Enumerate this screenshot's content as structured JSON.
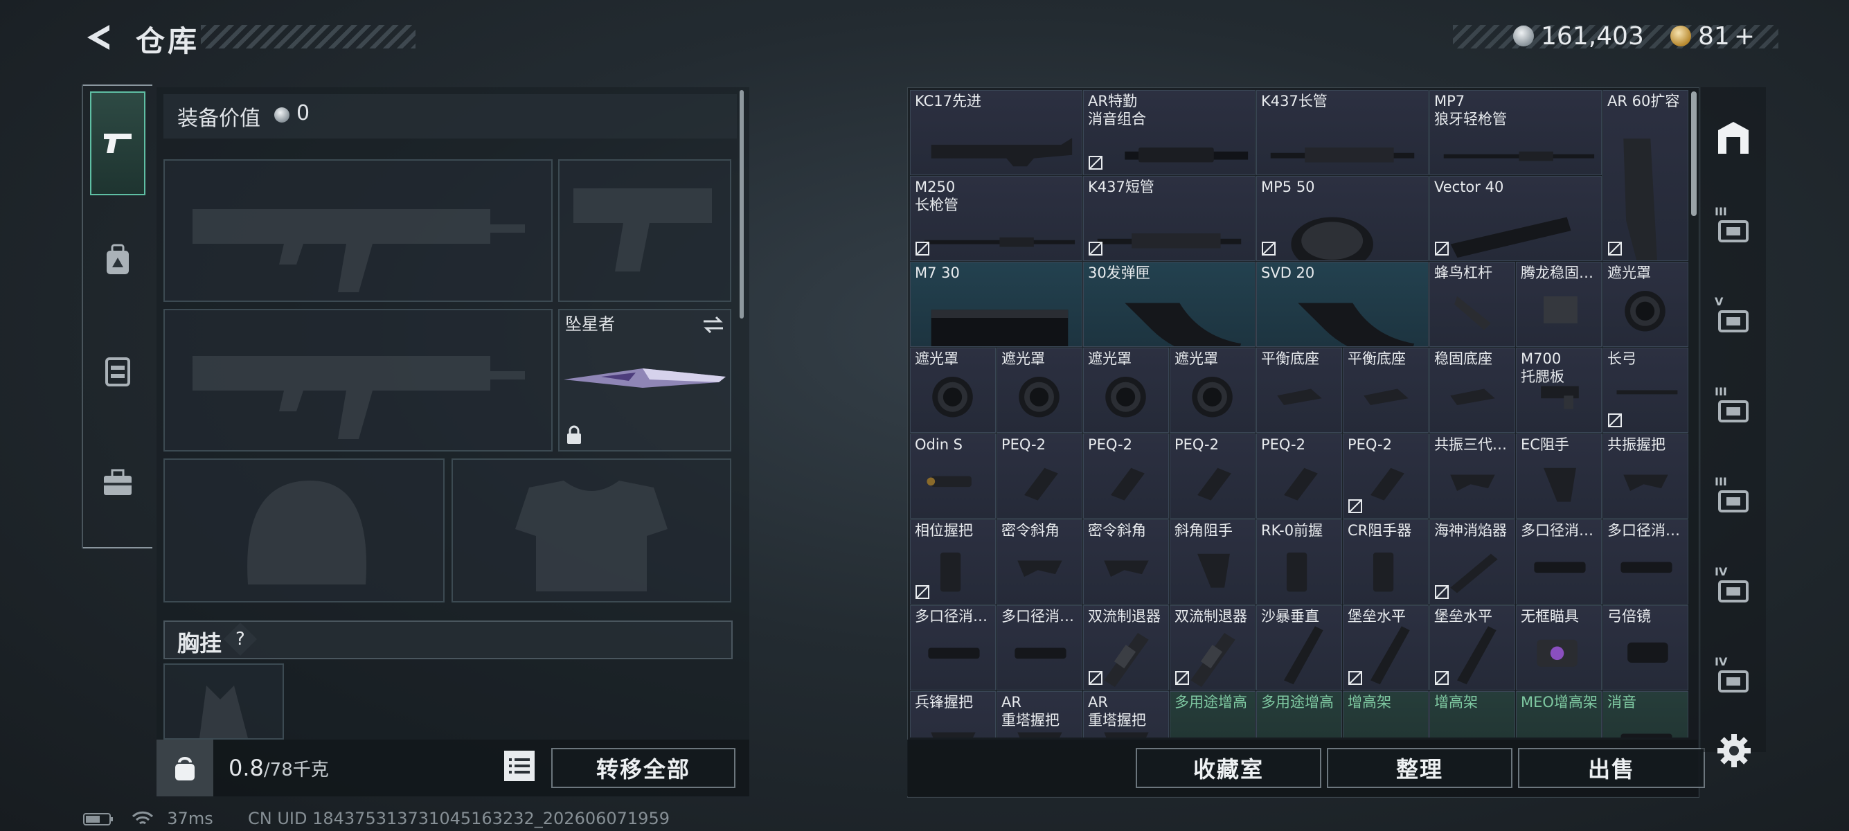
{
  "header": {
    "title": "仓库",
    "currency1": "161,403",
    "currency2": "81",
    "plus": "+"
  },
  "left_nav": [
    "weapon-icon",
    "backpack-icon",
    "vest-icon",
    "toolbox-icon"
  ],
  "equip": {
    "value_label": "装备价值",
    "value": "0",
    "melee_name": "坠星者",
    "chest_label": "胸挂",
    "help": "?"
  },
  "bottom_left": {
    "weight": "0.8",
    "weight_max": "/78千克",
    "transfer_label": "转移全部"
  },
  "bottom_right": {
    "collection": "收藏室",
    "sort": "整理",
    "sell": "出售"
  },
  "status": {
    "ping": "37ms",
    "uid": "CN UID 184375313731045163232_202606071959"
  },
  "inventory": [
    {
      "name": "KC17先进",
      "item": "stock"
    },
    {
      "name": "AR特勤\n消音组合",
      "item": "barrel-long",
      "locked": true
    },
    {
      "name": "K437长管",
      "item": "handguard"
    },
    {
      "name": "MP7\n狼牙轻枪管",
      "item": "barrel"
    },
    {
      "name": "AR 60扩容",
      "item": "mag-tall",
      "locked": true
    },
    {
      "name": "M250\n长枪管",
      "item": "barrel",
      "locked": true
    },
    {
      "name": "K437短管",
      "item": "handguard",
      "locked": true
    },
    {
      "name": "MP5 50",
      "item": "drum",
      "locked": true
    },
    {
      "name": "Vector 40",
      "item": "mag-long",
      "locked": true
    },
    {
      "name": "M7 30",
      "item": "mag-box",
      "blue": true
    },
    {
      "name": "30发弹匣",
      "item": "mag-curve",
      "blue": true
    },
    {
      "name": "SVD 20",
      "item": "mag-curve",
      "blue": true
    },
    {
      "name": "蜂鸟杠杆",
      "item": "lever"
    },
    {
      "name": "腾龙稳固…",
      "item": "mount"
    },
    {
      "name": "遮光罩",
      "item": "hood"
    },
    {
      "name": "遮光罩",
      "item": "hood"
    },
    {
      "name": "遮光罩",
      "item": "hood"
    },
    {
      "name": "遮光罩",
      "item": "hood"
    },
    {
      "name": "遮光罩",
      "item": "hood"
    },
    {
      "name": "平衡底座",
      "item": "base"
    },
    {
      "name": "平衡底座",
      "item": "base"
    },
    {
      "name": "稳固底座",
      "item": "base"
    },
    {
      "name": "M700\n托腮板",
      "item": "cheek"
    },
    {
      "name": "长弓",
      "item": "bar",
      "locked": true
    },
    {
      "name": "Odin S",
      "item": "laser"
    },
    {
      "name": "PEQ-2",
      "item": "peq"
    },
    {
      "name": "PEQ-2",
      "item": "peq"
    },
    {
      "name": "PEQ-2",
      "item": "peq"
    },
    {
      "name": "PEQ-2",
      "item": "peq"
    },
    {
      "name": "PEQ-2",
      "item": "peq",
      "locked": true
    },
    {
      "name": "共振三代…",
      "item": "grip-angle"
    },
    {
      "name": "EC阻手",
      "item": "grip-stop"
    },
    {
      "name": "共振握把",
      "item": "grip-angle"
    },
    {
      "name": "相位握把",
      "item": "grip-vert",
      "locked": true
    },
    {
      "name": "密令斜角",
      "item": "grip-angle"
    },
    {
      "name": "密令斜角",
      "item": "grip-angle"
    },
    {
      "name": "斜角阻手",
      "item": "grip-stop"
    },
    {
      "name": "RK-0前握",
      "item": "grip-vert"
    },
    {
      "name": "CR阻手器",
      "item": "grip-vert"
    },
    {
      "name": "海神消焰器",
      "item": "muzzle",
      "locked": true
    },
    {
      "name": "多口径消…",
      "item": "suppressor"
    },
    {
      "name": "多口径消…",
      "item": "suppressor"
    },
    {
      "name": "多口径消…",
      "item": "suppressor"
    },
    {
      "name": "多口径消…",
      "item": "suppressor"
    },
    {
      "name": "双流制退器",
      "item": "brake",
      "locked": true
    },
    {
      "name": "双流制退器",
      "item": "brake",
      "locked": true
    },
    {
      "name": "沙暴垂直",
      "item": "grip-long"
    },
    {
      "name": "堡垒水平",
      "item": "grip-long",
      "locked": true
    },
    {
      "name": "堡垒水平",
      "item": "grip-long",
      "locked": true
    },
    {
      "name": "无框瞄具",
      "item": "sight-holo"
    },
    {
      "name": "弓倍镜",
      "item": "scope"
    },
    {
      "name": "兵锋握把",
      "item": "grip-angle"
    },
    {
      "name": "AR\n重塔握把",
      "item": "grip-angle"
    },
    {
      "name": "AR\n重塔握把",
      "item": "grip-angle"
    },
    {
      "name": "多用途增高",
      "item": "riser",
      "green": true
    },
    {
      "name": "多用途增高",
      "item": "riser",
      "green": true
    },
    {
      "name": "增高架",
      "item": "riser",
      "green": true
    },
    {
      "name": "增高架",
      "item": "riser",
      "green": true
    },
    {
      "name": "MEO增高架",
      "item": "riser",
      "green": true
    },
    {
      "name": "消音",
      "item": "suppressor",
      "green": true
    }
  ],
  "right_nav": [
    {
      "label": "",
      "icon": "storage-icon"
    },
    {
      "label": "III",
      "icon": "craft-icon"
    },
    {
      "label": "V",
      "icon": "workbench-icon"
    },
    {
      "label": "III",
      "icon": "train-icon"
    },
    {
      "label": "III",
      "icon": "upgrade-icon"
    },
    {
      "label": "IV",
      "icon": "folder-icon"
    },
    {
      "label": "IV",
      "icon": "add-icon"
    }
  ]
}
